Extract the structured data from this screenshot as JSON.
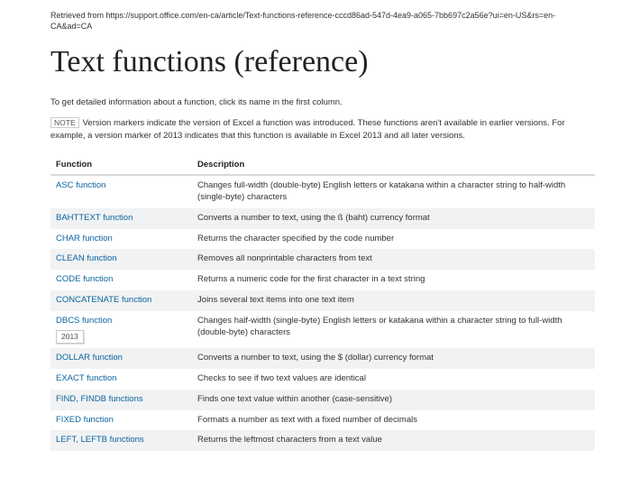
{
  "retrieved": "Retrieved from https://support.office.com/en-ca/article/Text-functions-reference-cccd86ad-547d-4ea9-a065-7bb697c2a56e?ui=en-US&rs=en-CA&ad=CA",
  "title": "Text functions (reference)",
  "intro": "To get detailed information about a function, click its name in the first column.",
  "note_label": "NOTE",
  "note_text": "Version markers indicate the version of Excel a function was introduced. These functions aren't available in earlier versions. For example, a version marker of 2013 indicates that this function is available in Excel 2013 and all later versions.",
  "headers": {
    "name": "Function",
    "desc": "Description"
  },
  "rows": [
    {
      "name": "ASC function",
      "desc": "Changes full-width (double-byte) English letters or katakana within a character string to half-width (single-byte) characters",
      "marker": ""
    },
    {
      "name": "BAHTTEXT function",
      "desc": "Converts a number to text, using the ß (baht) currency format",
      "marker": ""
    },
    {
      "name": "CHAR function",
      "desc": "Returns the character specified by the code number",
      "marker": ""
    },
    {
      "name": "CLEAN function",
      "desc": "Removes all nonprintable characters from text",
      "marker": ""
    },
    {
      "name": "CODE function",
      "desc": "Returns a numeric code for the first character in a text string",
      "marker": ""
    },
    {
      "name": "CONCATENATE function",
      "desc": "Joins several text items into one text item",
      "marker": ""
    },
    {
      "name": "DBCS function",
      "desc": "Changes half-width (single-byte) English letters or katakana within a character string to full-width (double-byte) characters",
      "marker": "2013"
    },
    {
      "name": "DOLLAR function",
      "desc": "Converts a number to text, using the $ (dollar) currency format",
      "marker": ""
    },
    {
      "name": "EXACT function",
      "desc": "Checks to see if two text values are identical",
      "marker": ""
    },
    {
      "name": "FIND, FINDB functions",
      "desc": "Finds one text value within another (case-sensitive)",
      "marker": ""
    },
    {
      "name": "FIXED function",
      "desc": "Formats a number as text with a fixed number of decimals",
      "marker": ""
    },
    {
      "name": "LEFT, LEFTB functions",
      "desc": "Returns the leftmost characters from a text value",
      "marker": ""
    }
  ]
}
